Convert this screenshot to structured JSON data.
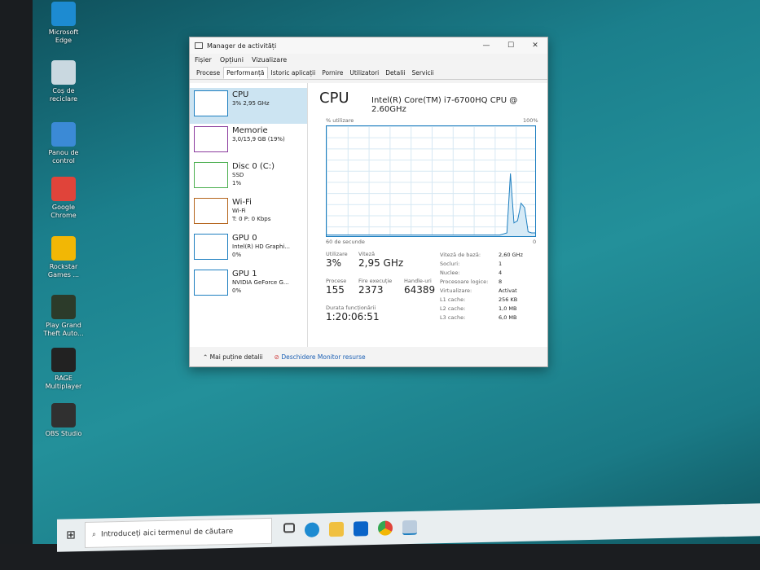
{
  "desktop": {
    "icons": [
      {
        "label": "Microsoft Edge",
        "color": "#1d8bd1"
      },
      {
        "label": "Coș de reciclare",
        "color": "#c9d8e0"
      },
      {
        "label": "Panou de control",
        "color": "#3b8ad6"
      },
      {
        "label": "Google Chrome",
        "color": "#e0443a"
      },
      {
        "label": "Rockstar Games ...",
        "color": "#f2b705"
      },
      {
        "label": "Play Grand Theft Auto...",
        "color": "#2c3b2a"
      },
      {
        "label": "RAGE Multiplayer",
        "color": "#222222"
      },
      {
        "label": "OBS Studio",
        "color": "#303030"
      }
    ]
  },
  "window": {
    "title": "Manager de activități",
    "controls": [
      "—",
      "☐",
      "✕"
    ],
    "menu": [
      "Fișier",
      "Opțiuni",
      "Vizualizare"
    ],
    "tabs": [
      "Procese",
      "Performanță",
      "Istoric aplicații",
      "Pornire",
      "Utilizatori",
      "Detalii",
      "Servicii"
    ],
    "active_tab": 1,
    "sidebar": [
      {
        "title": "CPU",
        "line1": "3% 2,95 GHz",
        "line2": "",
        "color": "#1e7fc0"
      },
      {
        "title": "Memorie",
        "line1": "3,0/15,9 GB (19%)",
        "line2": "",
        "color": "#8b3c9e"
      },
      {
        "title": "Disc 0 (C:)",
        "line1": "SSD",
        "line2": "1%",
        "color": "#4caf50"
      },
      {
        "title": "Wi-Fi",
        "line1": "Wi-Fi",
        "line2": "T: 0 P: 0 Kbps",
        "color": "#b5651d"
      },
      {
        "title": "GPU 0",
        "line1": "Intel(R) HD Graphi...",
        "line2": "0%",
        "color": "#1e7fc0"
      },
      {
        "title": "GPU 1",
        "line1": "NVIDIA GeForce G...",
        "line2": "0%",
        "color": "#1e7fc0"
      }
    ],
    "main": {
      "title": "CPU",
      "cpu_name": "Intel(R) Core(TM) i7-6700HQ CPU @ 2.60GHz",
      "graph_label": "% utilizare",
      "graph_max": "100%",
      "graph_time": "60 de secunde",
      "graph_min": "0",
      "stats": {
        "util_label": "Utilizare",
        "util": "3%",
        "speed_label": "Viteză",
        "speed": "2,95 GHz",
        "proc_label": "Procese",
        "proc": "155",
        "threads_label": "Fire execuție",
        "threads": "2373",
        "handles_label": "Handle-uri",
        "handles": "64389",
        "uptime_label": "Durata funcționării",
        "uptime": "1:20:06:51"
      },
      "specs": [
        [
          "Viteză de bază:",
          "2,60 GHz"
        ],
        [
          "Socluri:",
          "1"
        ],
        [
          "Nuclee:",
          "4"
        ],
        [
          "Procesoare logice:",
          "8"
        ],
        [
          "Virtualizare:",
          "Activat"
        ],
        [
          "L1 cache:",
          "256 KB"
        ],
        [
          "L2 cache:",
          "1,0 MB"
        ],
        [
          "L3 cache:",
          "6,0 MB"
        ]
      ]
    },
    "footer": {
      "less": "Mai puține detalii",
      "monitor": "Deschidere Monitor resurse"
    }
  },
  "chart_data": {
    "type": "line",
    "title": "CPU % utilizare",
    "xlabel": "60 de secunde",
    "ylim": [
      0,
      100
    ],
    "values": [
      1,
      1,
      1,
      1,
      1,
      1,
      1,
      1,
      1,
      1,
      1,
      1,
      1,
      1,
      1,
      1,
      1,
      1,
      1,
      1,
      1,
      1,
      1,
      1,
      1,
      1,
      1,
      1,
      1,
      1,
      1,
      1,
      1,
      1,
      1,
      1,
      1,
      1,
      1,
      1,
      1,
      1,
      1,
      1,
      1,
      1,
      1,
      1,
      1,
      1,
      2,
      3,
      57,
      12,
      14,
      30,
      26,
      4,
      3,
      3
    ]
  },
  "taskbar": {
    "search_placeholder": "Introduceți aici termenul de căutare",
    "start": "⊞"
  }
}
